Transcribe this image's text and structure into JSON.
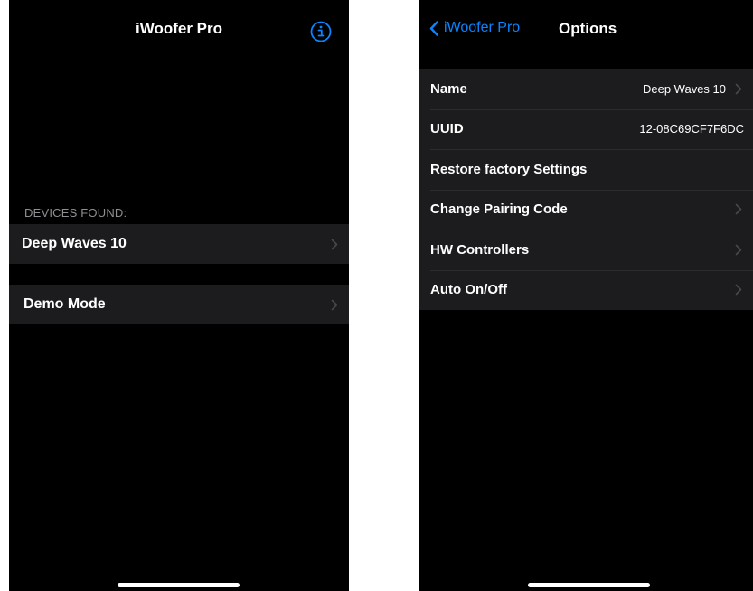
{
  "left_screen": {
    "title": "iWoofer Pro",
    "info_icon": "info-circle-icon",
    "section_header": "DEVICES FOUND:",
    "device_row": {
      "label": "Deep Waves 10"
    },
    "demo_row": {
      "label": "Demo Mode"
    }
  },
  "right_screen": {
    "back_label": "iWoofer Pro",
    "title": "Options",
    "rows": [
      {
        "label": "Name",
        "value": "Deep Waves 10",
        "chevron": true
      },
      {
        "label": "UUID",
        "value": "12-08C69CF7F6DC",
        "chevron": false
      },
      {
        "label": "Restore factory Settings",
        "value": "",
        "chevron": false
      },
      {
        "label": "Change Pairing Code",
        "value": "",
        "chevron": true
      },
      {
        "label": "HW Controllers",
        "value": "",
        "chevron": true
      },
      {
        "label": "Auto On/Off",
        "value": "",
        "chevron": true
      }
    ]
  },
  "colors": {
    "background": "#000000",
    "row_background": "#1c1c1e",
    "accent": "#0a84ff",
    "chevron": "#48484a",
    "section_header": "#8e8e93"
  }
}
